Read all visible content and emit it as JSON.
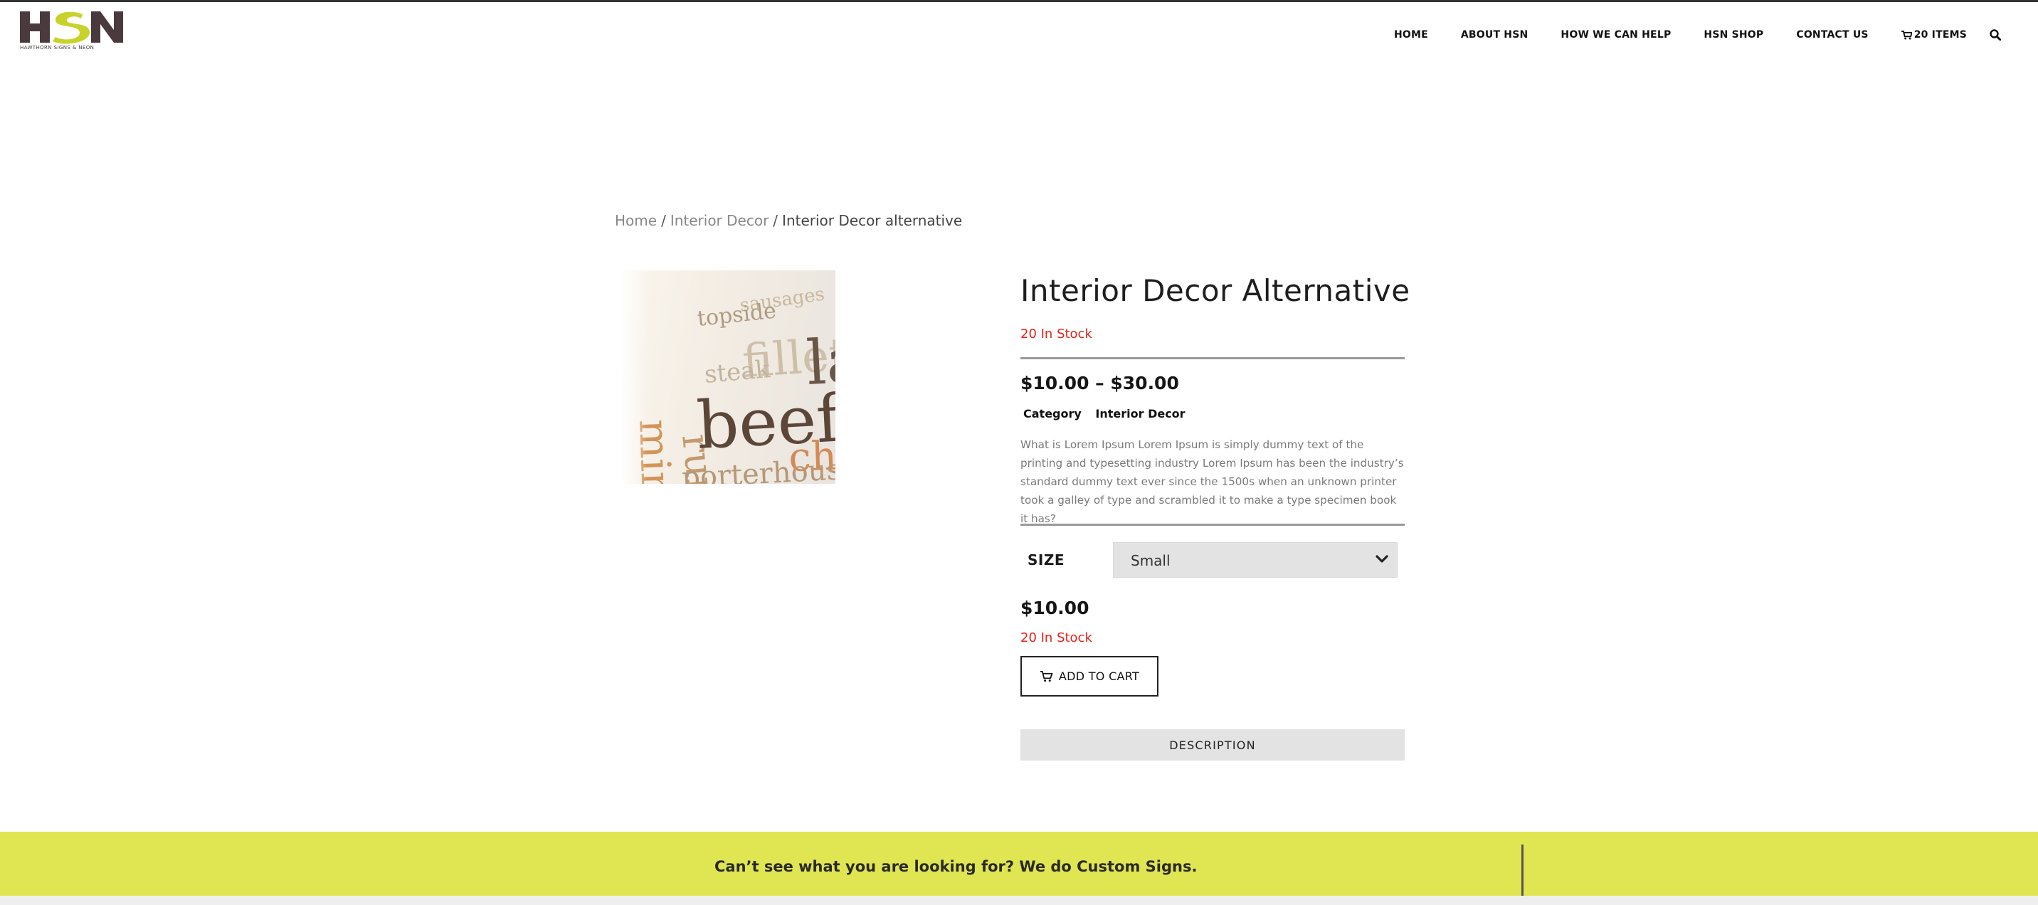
{
  "header": {
    "logo_text": "HSN",
    "logo_tagline": "HAWTHORN SIGNS & NEON",
    "nav": [
      {
        "label": "HOME"
      },
      {
        "label": "ABOUT HSN"
      },
      {
        "label": "HOW WE CAN HELP"
      },
      {
        "label": "HSN SHOP"
      },
      {
        "label": "CONTACT US"
      }
    ],
    "cart_label": "20 ITEMS"
  },
  "breadcrumb": {
    "home": "Home",
    "separator": "/",
    "category": "Interior Decor",
    "current": "Interior Decor alternative"
  },
  "product": {
    "title": "Interior Decor Alternative",
    "stock_text": "20 In Stock",
    "price_range": "$10.00 – $30.00",
    "category_label": "Category",
    "category_value": "Interior Decor",
    "description": "What is Lorem Ipsum Lorem Ipsum is simply dummy text of the printing and typesetting industry Lorem Ipsum has been the industry’s standard dummy text ever since the 1500s when an unknown printer took a galley of type and scrambled it to make a type specimen book it has?",
    "size_label": "SIZE",
    "size_selected": "Small",
    "variation_price": "$10.00",
    "variation_stock": "20 In Stock",
    "add_to_cart_label": "ADD TO CART",
    "tab_description_label": "DESCRIPTION",
    "image_words": [
      "sausages",
      "topside",
      "fillet",
      "lamb",
      "steak",
      "rump",
      "beef",
      "chicken",
      "porterhouse",
      "mince"
    ]
  },
  "cta": {
    "text": "Can’t see what you are looking for? We do Custom Signs."
  },
  "colors": {
    "accent_yellow": "#e0e552",
    "stock_red": "#e2231a",
    "logo_dark": "#4a3a3d",
    "logo_lime": "#c9d22a"
  }
}
